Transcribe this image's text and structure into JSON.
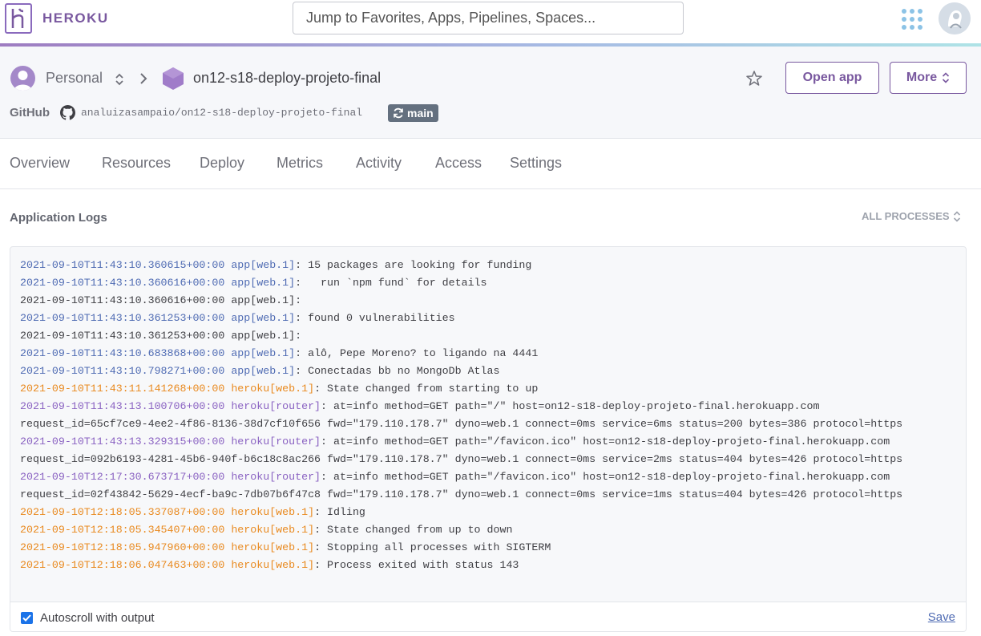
{
  "brand": "HEROKU",
  "search": {
    "placeholder": "Jump to Favorites, Apps, Pipelines, Spaces..."
  },
  "header": {
    "account": "Personal",
    "app_name": "on12-s18-deploy-projeto-final",
    "open_app": "Open app",
    "more": "More",
    "source_label": "GitHub",
    "repo": "analuizasampaio/on12-s18-deploy-projeto-final",
    "branch": "main"
  },
  "tabs": [
    "Overview",
    "Resources",
    "Deploy",
    "Metrics",
    "Activity",
    "Access",
    "Settings"
  ],
  "logs": {
    "title": "Application Logs",
    "process_filter": "ALL PROCESSES",
    "lines": [
      {
        "color": "blue",
        "prefix": "2021-09-10T11:43:10.360615+00:00 app[web.1]",
        "text": ": 15 packages are looking for funding"
      },
      {
        "color": "blue",
        "prefix": "2021-09-10T11:43:10.360616+00:00 app[web.1]",
        "text": ":   run `npm fund` for details"
      },
      {
        "color": "none",
        "prefix": "2021-09-10T11:43:10.360616+00:00 app[web.1]",
        "text": ":"
      },
      {
        "color": "blue",
        "prefix": "2021-09-10T11:43:10.361253+00:00 app[web.1]",
        "text": ": found 0 vulnerabilities"
      },
      {
        "color": "none",
        "prefix": "2021-09-10T11:43:10.361253+00:00 app[web.1]",
        "text": ":"
      },
      {
        "color": "blue",
        "prefix": "2021-09-10T11:43:10.683868+00:00 app[web.1]",
        "text": ": alô, Pepe Moreno? to ligando na 4441"
      },
      {
        "color": "blue",
        "prefix": "2021-09-10T11:43:10.798271+00:00 app[web.1]",
        "text": ": Conectadas bb no MongoDb Atlas"
      },
      {
        "color": "orange",
        "prefix": "2021-09-10T11:43:11.141268+00:00 heroku[web.1]",
        "text": ": State changed from starting to up"
      },
      {
        "color": "purple",
        "prefix": "2021-09-10T11:43:13.100706+00:00 heroku[router]",
        "text": ": at=info method=GET path=\"/\" host=on12-s18-deploy-projeto-final.herokuapp.com"
      },
      {
        "color": "none",
        "prefix": "",
        "text": "request_id=65cf7ce9-4ee2-4f86-8136-38d7cf10f656 fwd=\"179.110.178.7\" dyno=web.1 connect=0ms service=6ms status=200 bytes=386 protocol=https"
      },
      {
        "color": "purple",
        "prefix": "2021-09-10T11:43:13.329315+00:00 heroku[router]",
        "text": ": at=info method=GET path=\"/favicon.ico\" host=on12-s18-deploy-projeto-final.herokuapp.com"
      },
      {
        "color": "none",
        "prefix": "",
        "text": "request_id=092b6193-4281-45b6-940f-b6c18c8ac266 fwd=\"179.110.178.7\" dyno=web.1 connect=0ms service=2ms status=404 bytes=426 protocol=https"
      },
      {
        "color": "purple",
        "prefix": "2021-09-10T12:17:30.673717+00:00 heroku[router]",
        "text": ": at=info method=GET path=\"/favicon.ico\" host=on12-s18-deploy-projeto-final.herokuapp.com"
      },
      {
        "color": "none",
        "prefix": "",
        "text": "request_id=02f43842-5629-4ecf-ba9c-7db07b6f47c8 fwd=\"179.110.178.7\" dyno=web.1 connect=0ms service=1ms status=404 bytes=426 protocol=https"
      },
      {
        "color": "orange",
        "prefix": "2021-09-10T12:18:05.337087+00:00 heroku[web.1]",
        "text": ": Idling"
      },
      {
        "color": "orange",
        "prefix": "2021-09-10T12:18:05.345407+00:00 heroku[web.1]",
        "text": ": State changed from up to down"
      },
      {
        "color": "orange",
        "prefix": "2021-09-10T12:18:05.947960+00:00 heroku[web.1]",
        "text": ": Stopping all processes with SIGTERM"
      },
      {
        "color": "orange",
        "prefix": "2021-09-10T12:18:06.047463+00:00 heroku[web.1]",
        "text": ": Process exited with status 143"
      }
    ],
    "autoscroll_label": "Autoscroll with output",
    "autoscroll_checked": true,
    "save": "Save"
  },
  "colors": {
    "brand": "#79589f",
    "log_app": "#4f6bb3",
    "log_heroku": "#e98a20",
    "log_router": "#8a62c2"
  }
}
